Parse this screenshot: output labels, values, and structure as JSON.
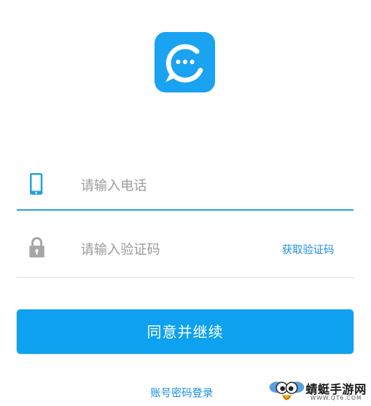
{
  "app": {
    "logo_icon": "chat-bubble-c-logo-icon",
    "accent_color": "#19a3f0"
  },
  "phone_field": {
    "icon": "phone-icon",
    "placeholder": "请输入电话",
    "value": ""
  },
  "code_field": {
    "icon": "lock-icon",
    "placeholder": "请输入验证码",
    "value": "",
    "get_code_label": "获取验证码"
  },
  "primary_button": {
    "label": "同意并继续",
    "color": "#0ea1ef"
  },
  "password_login_label": "账号密码登录",
  "watermark": {
    "title": "蜻蜓手游网",
    "url": "WWW.QT6.COM"
  }
}
